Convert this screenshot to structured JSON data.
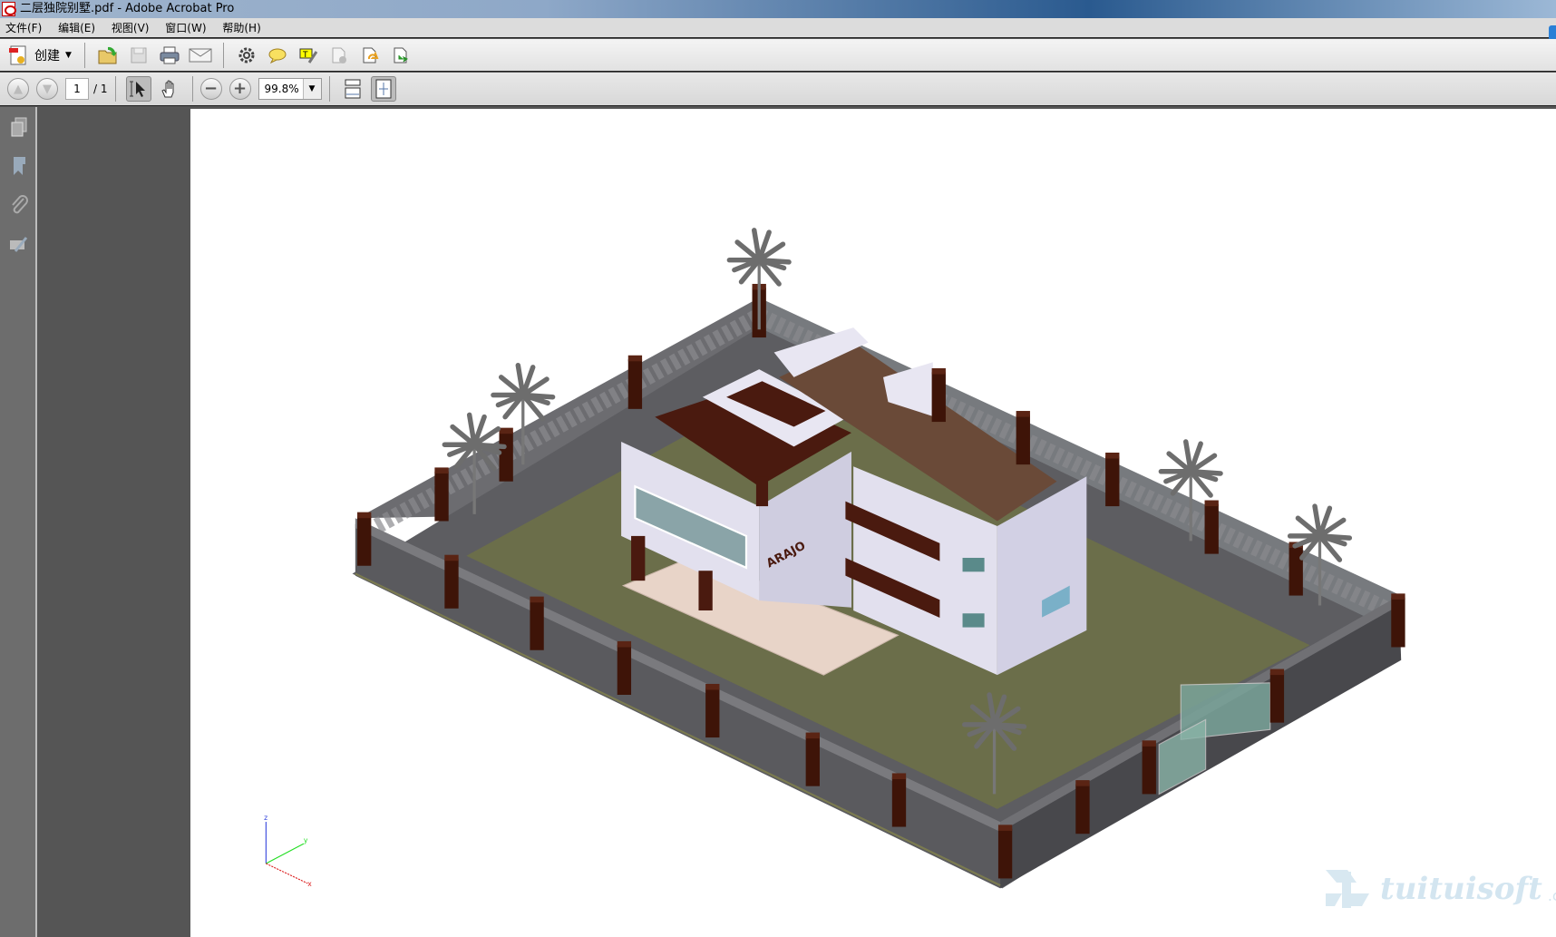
{
  "window": {
    "title": "二层独院别墅.pdf - Adobe Acrobat Pro"
  },
  "menu": [
    "文件(F)",
    "编辑(E)",
    "视图(V)",
    "窗口(W)",
    "帮助(H)"
  ],
  "toolbar": {
    "create_label": "创建",
    "icons": [
      "open-icon",
      "save-icon",
      "print-icon",
      "email-icon",
      "settings-icon",
      "comment-icon",
      "highlight-text-icon",
      "secure-icon",
      "share-icon",
      "export-icon"
    ]
  },
  "nav": {
    "page_current": "1",
    "page_total": "/ 1",
    "zoom": "99.8%"
  },
  "sidebar": {
    "icons": [
      "pages-icon",
      "bookmarks-icon",
      "attachments-icon",
      "signatures-icon"
    ]
  },
  "model": {
    "axis_labels": [
      "z",
      "y",
      "x"
    ],
    "colors": {
      "grass": "#6b6e4a",
      "wall": "#5e5e62",
      "house": "#d8d6e8",
      "roof": "#4a1a0f",
      "deck": "#6a4a38",
      "terrace": "#e8d4c8"
    }
  },
  "watermark": {
    "text": "tuituisoft",
    ".com": ".com"
  }
}
